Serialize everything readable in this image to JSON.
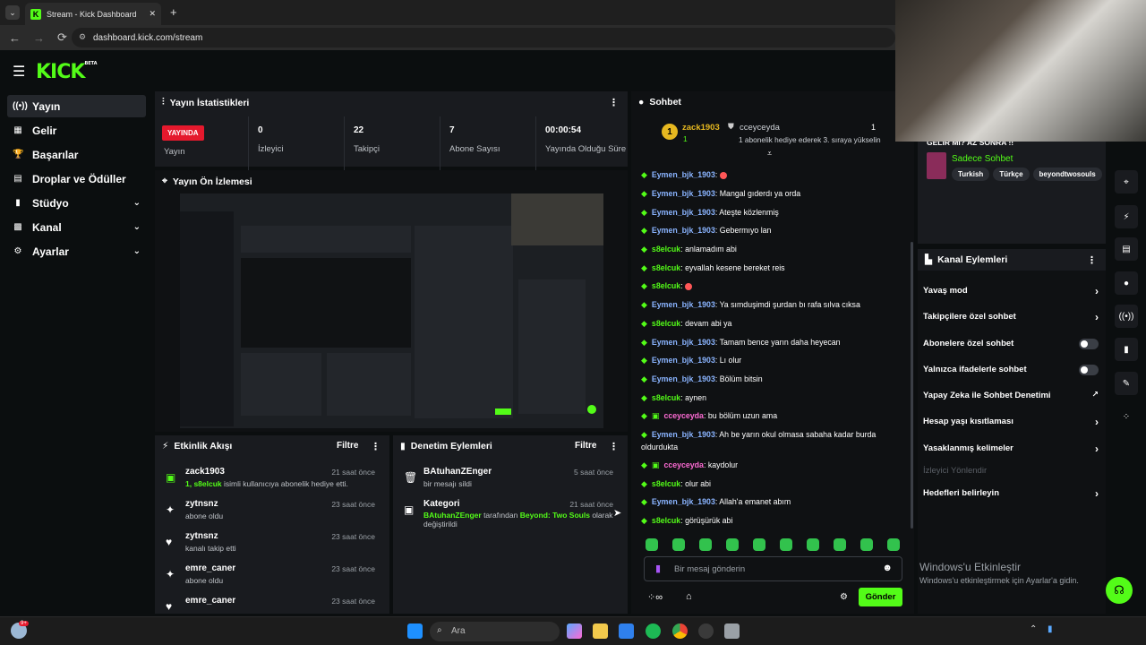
{
  "browser": {
    "tab_title": "Stream - Kick Dashboard",
    "tab_close": "✕",
    "new_tab": "+",
    "url": "dashboard.kick.com/stream",
    "nav_back": "←",
    "nav_forward": "→",
    "nav_reload": "⟳"
  },
  "app": {
    "logo": "KICK",
    "logo_beta": "BETA",
    "menu_icon": "☰"
  },
  "sidebar": {
    "items": [
      {
        "label": "Yayın",
        "icon": "((•))",
        "active": true
      },
      {
        "label": "Gelir",
        "icon": "▦"
      },
      {
        "label": "Başarılar",
        "icon": "🏆"
      },
      {
        "label": "Droplar ve Ödüller",
        "icon": "▤"
      },
      {
        "label": "Stüdyo",
        "icon": "▮",
        "chevron": "⌄"
      },
      {
        "label": "Kanal",
        "icon": "▩",
        "chevron": "⌄"
      },
      {
        "label": "Ayarlar",
        "icon": "⚙",
        "chevron": "⌄"
      }
    ]
  },
  "stats": {
    "title": "Yayın İstatistikleri",
    "live_badge": "YAYINDA",
    "items": [
      {
        "label": "Yayın",
        "value": ""
      },
      {
        "label": "İzleyici",
        "value": "0"
      },
      {
        "label": "Takipçi",
        "value": "22"
      },
      {
        "label": "Abone Sayısı",
        "value": "7"
      },
      {
        "label": "Yayında Olduğu Süre",
        "value": "00:00:54"
      }
    ]
  },
  "preview": {
    "title": "Yayın Ön İzlemesi"
  },
  "activity": {
    "title": "Etkinlik Akışı",
    "filter": "Filtre",
    "items": [
      {
        "name": "zack1903",
        "time": "21 saat önce",
        "highlight": "1, s8elcuk",
        "sub": " isimli kullanıcıya abonelik hediye etti.",
        "icon": "🎁"
      },
      {
        "name": "zytnsnz",
        "time": "23 saat önce",
        "sub": "abone oldu",
        "icon": "✦"
      },
      {
        "name": "zytnsnz",
        "time": "23 saat önce",
        "sub": "kanalı takip etti",
        "icon": "♥"
      },
      {
        "name": "emre_caner",
        "time": "23 saat önce",
        "sub": "abone oldu",
        "icon": "✦"
      },
      {
        "name": "emre_caner",
        "time": "23 saat önce",
        "sub": "",
        "icon": "♥"
      }
    ]
  },
  "moderation": {
    "title": "Denetim Eylemleri",
    "filter": "Filtre",
    "items": [
      {
        "name": "BAtuhanZEnger",
        "time": "5 saat önce",
        "sub": "bir mesajı sildi",
        "icon": "🗑"
      },
      {
        "name": "Kategori",
        "time": "21 saat önce",
        "actor": "BAtuhanZEnger",
        "mid": " tarafından ",
        "target": "Beyond: Two Souls",
        "tail": " olarak değiştirildi",
        "icon": "▣"
      }
    ]
  },
  "chat": {
    "title": "Sohbet",
    "pinned": {
      "user1": "zack1903",
      "user1_rank": "1",
      "user2": "cceyceyda",
      "user2_rank": "1",
      "message": "1 abonelik hediye ederek 3. sıraya yükselin",
      "rank_badge": "1"
    },
    "messages": [
      {
        "user": "Eymen_bjk_1903",
        "color": "blue",
        "text": "",
        "emote": true
      },
      {
        "user": "Eymen_bjk_1903",
        "color": "blue",
        "text": "Mangal gıderdı ya orda"
      },
      {
        "user": "Eymen_bjk_1903",
        "color": "blue",
        "text": "Ateşte közlenmiş"
      },
      {
        "user": "Eymen_bjk_1903",
        "color": "blue",
        "text": "Gebermıyo lan"
      },
      {
        "user": "s8elcuk",
        "color": "green",
        "text": "anlamadım abi"
      },
      {
        "user": "s8elcuk",
        "color": "green",
        "text": "eyvallah kesene bereket reis"
      },
      {
        "user": "s8elcuk",
        "color": "green",
        "text": "",
        "emote": true
      },
      {
        "user": "Eymen_bjk_1903",
        "color": "blue",
        "text": "Ya sımduşimdi şurdan bı rafa sılva cıksa"
      },
      {
        "user": "s8elcuk",
        "color": "green",
        "text": "devam abi ya"
      },
      {
        "user": "Eymen_bjk_1903",
        "color": "blue",
        "text": "Tamam bence yarın daha heyecan"
      },
      {
        "user": "Eymen_bjk_1903",
        "color": "blue",
        "text": "Lı olur"
      },
      {
        "user": "Eymen_bjk_1903",
        "color": "blue",
        "text": "Bölüm bitsin"
      },
      {
        "user": "s8elcuk",
        "color": "green",
        "text": "aynen"
      },
      {
        "user": "cceyceyda",
        "color": "pink",
        "text": "bu bölüm uzun ama"
      },
      {
        "user": "Eymen_bjk_1903",
        "color": "blue",
        "text": "Ah be yarın okul olmasa sabaha kadar burda oldurdukta"
      },
      {
        "user": "cceyceyda",
        "color": "pink",
        "text": "kaydolur"
      },
      {
        "user": "s8elcuk",
        "color": "green",
        "text": "olur abi"
      },
      {
        "user": "Eymen_bjk_1903",
        "color": "blue",
        "text": "Allah'a emanet abım"
      },
      {
        "user": "s8elcuk",
        "color": "green",
        "text": "görüşürük abi"
      }
    ],
    "input_placeholder": "Bir mesaj gönderin",
    "send": "Gönder"
  },
  "stream_info": {
    "banner": "GELİR Mİ? AZ SONRA !!",
    "mode": "Sadece Sohbet",
    "tags": [
      "Turkish",
      "Türkçe",
      "beyondtwosouls"
    ]
  },
  "channel_actions": {
    "title": "Kanal Eylemleri",
    "items": [
      {
        "label": "Yavaş mod",
        "type": "arrow"
      },
      {
        "label": "Takipçilere özel sohbet",
        "type": "arrow"
      },
      {
        "label": "Abonelere özel sohbet",
        "type": "toggle"
      },
      {
        "label": "Yalnızca ifadelerle sohbet",
        "type": "toggle"
      },
      {
        "label": "Yapay Zeka ile Sohbet Denetimi",
        "type": "external"
      },
      {
        "label": "Hesap yaşı kısıtlaması",
        "type": "arrow"
      },
      {
        "label": "Yasaklanmış kelimeler",
        "type": "arrow"
      },
      {
        "label": "İzleyici Yönlendir",
        "type": "disabled"
      },
      {
        "label": "Hedefleri belirleyin",
        "type": "arrow"
      }
    ]
  },
  "windows": {
    "activate_title": "Windows'u Etkinleştir",
    "activate_sub": "Windows'u etkinleştirmek için Ayarlar'a gidin.",
    "search": "Ara",
    "notif_badge": "9+"
  }
}
